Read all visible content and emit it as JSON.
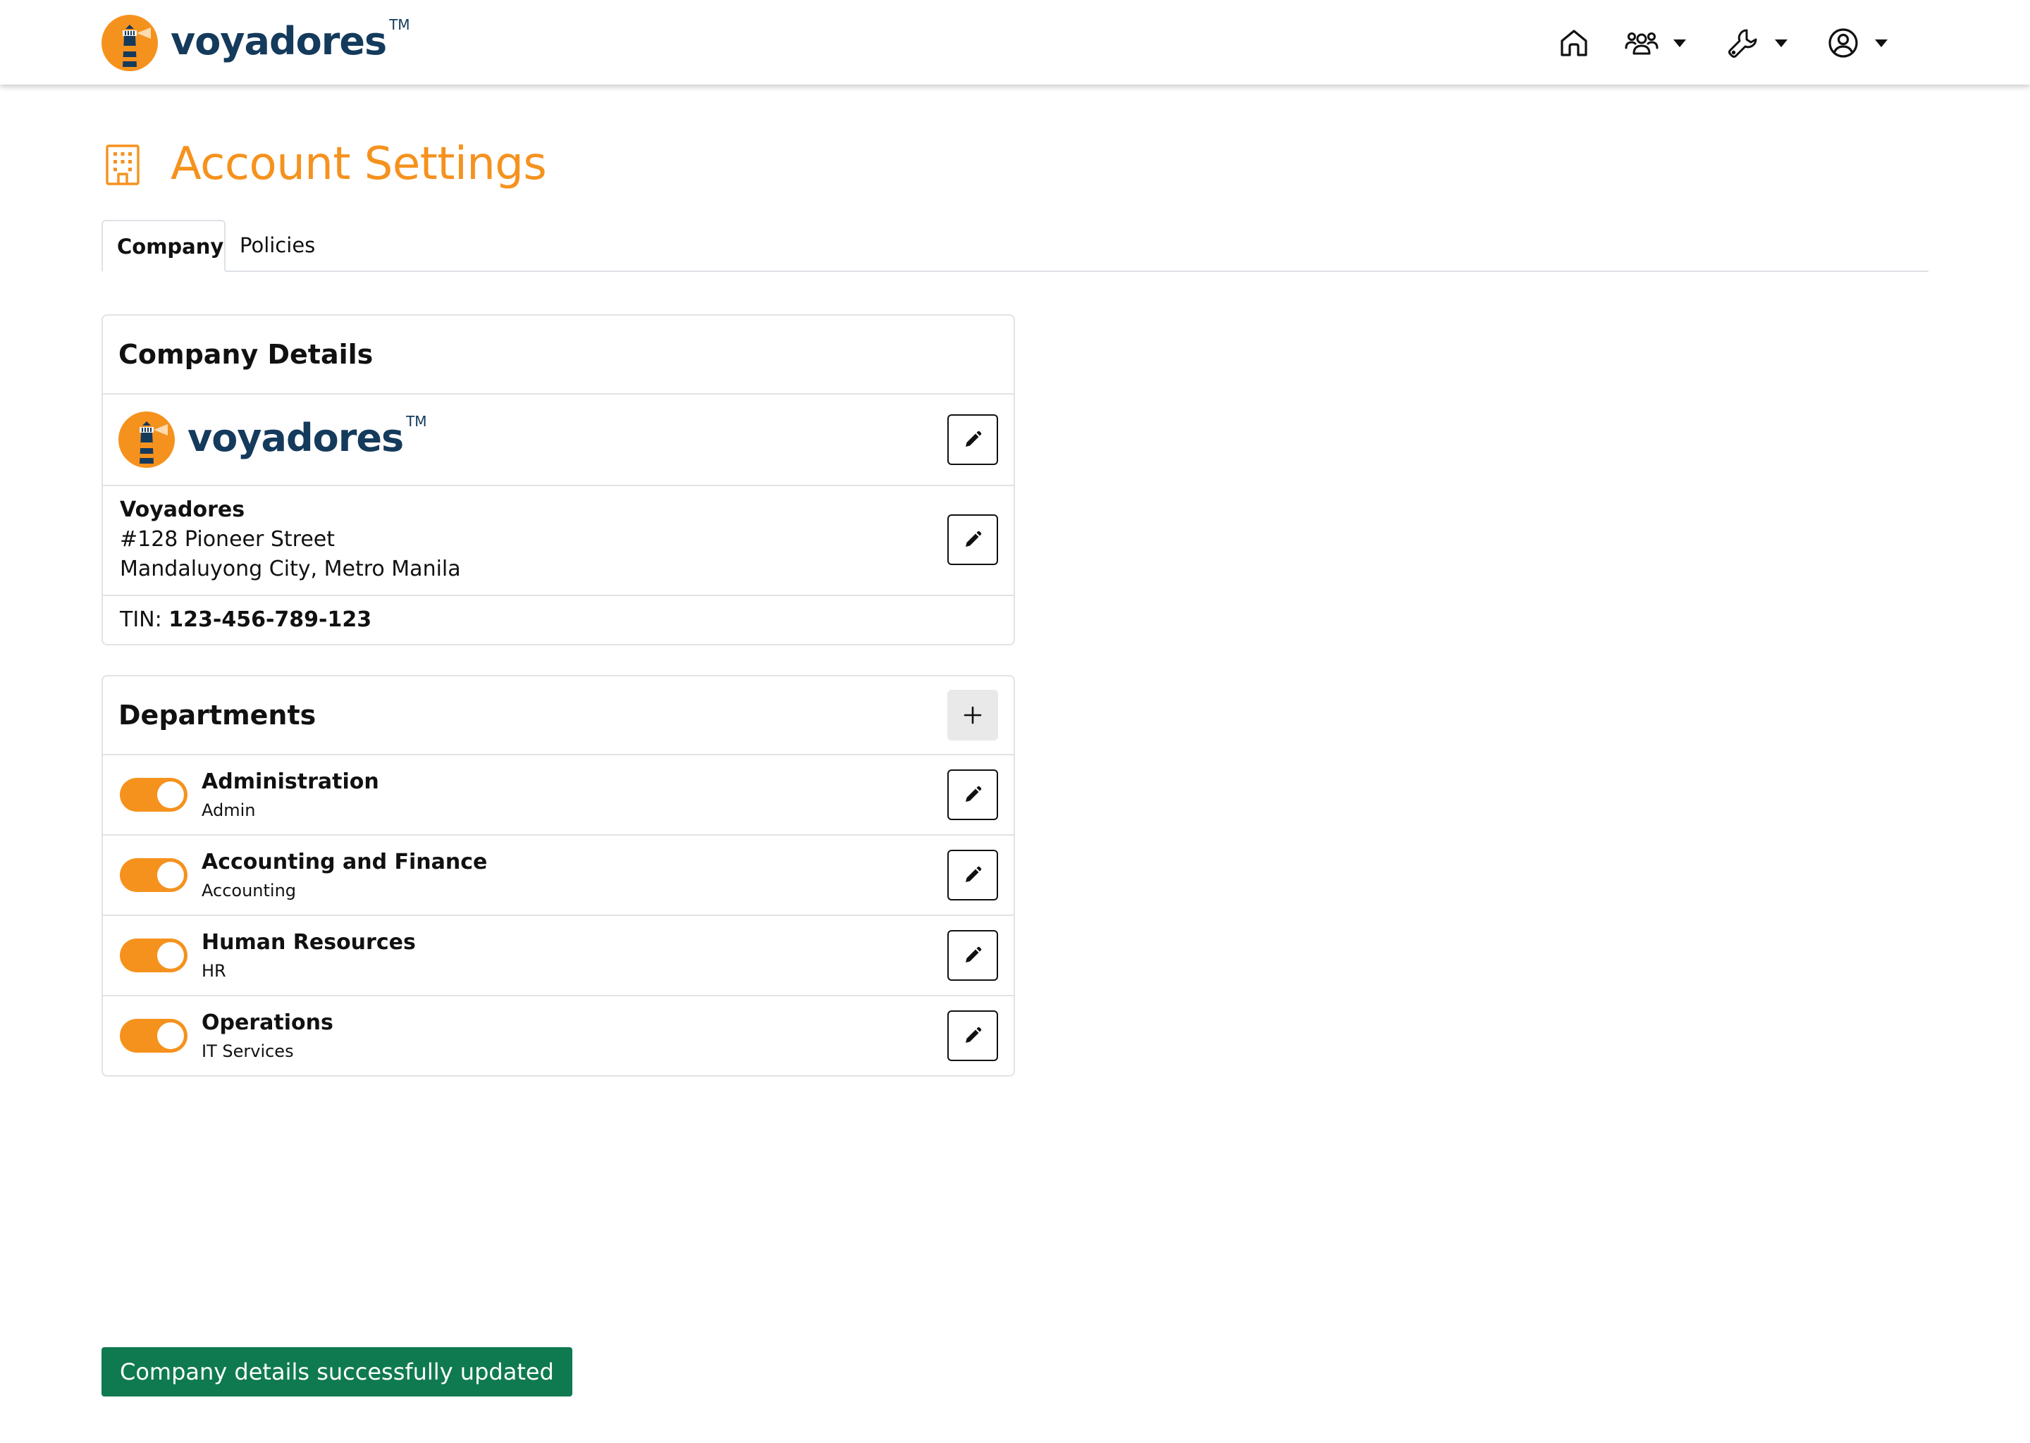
{
  "brand": {
    "name": "voyadores",
    "tm": "TM"
  },
  "colors": {
    "accent": "#f5921e",
    "brand_navy": "#143a5c",
    "success": "#0f7a4f"
  },
  "nav": {
    "icons": [
      "home-icon",
      "people-icon",
      "wrench-icon",
      "user-circle-icon"
    ]
  },
  "page": {
    "title": "Account Settings",
    "icon": "building-icon"
  },
  "tabs": [
    {
      "label": "Company",
      "active": true
    },
    {
      "label": "Policies",
      "active": false
    }
  ],
  "company_details": {
    "title": "Company Details",
    "logo_word": "voyadores",
    "logo_tm": "TM",
    "name": "Voyadores",
    "address_line1": "#128 Pioneer Street",
    "address_line2": "Mandaluyong City, Metro Manila",
    "tin_label": "TIN:",
    "tin_value": "123-456-789-123"
  },
  "departments": {
    "title": "Departments",
    "items": [
      {
        "name": "Administration",
        "code": "Admin",
        "enabled": true
      },
      {
        "name": "Accounting and Finance",
        "code": "Accounting",
        "enabled": true
      },
      {
        "name": "Human Resources",
        "code": "HR",
        "enabled": true
      },
      {
        "name": "Operations",
        "code": "IT Services",
        "enabled": true
      }
    ]
  },
  "toast": {
    "message": "Company details successfully updated"
  }
}
